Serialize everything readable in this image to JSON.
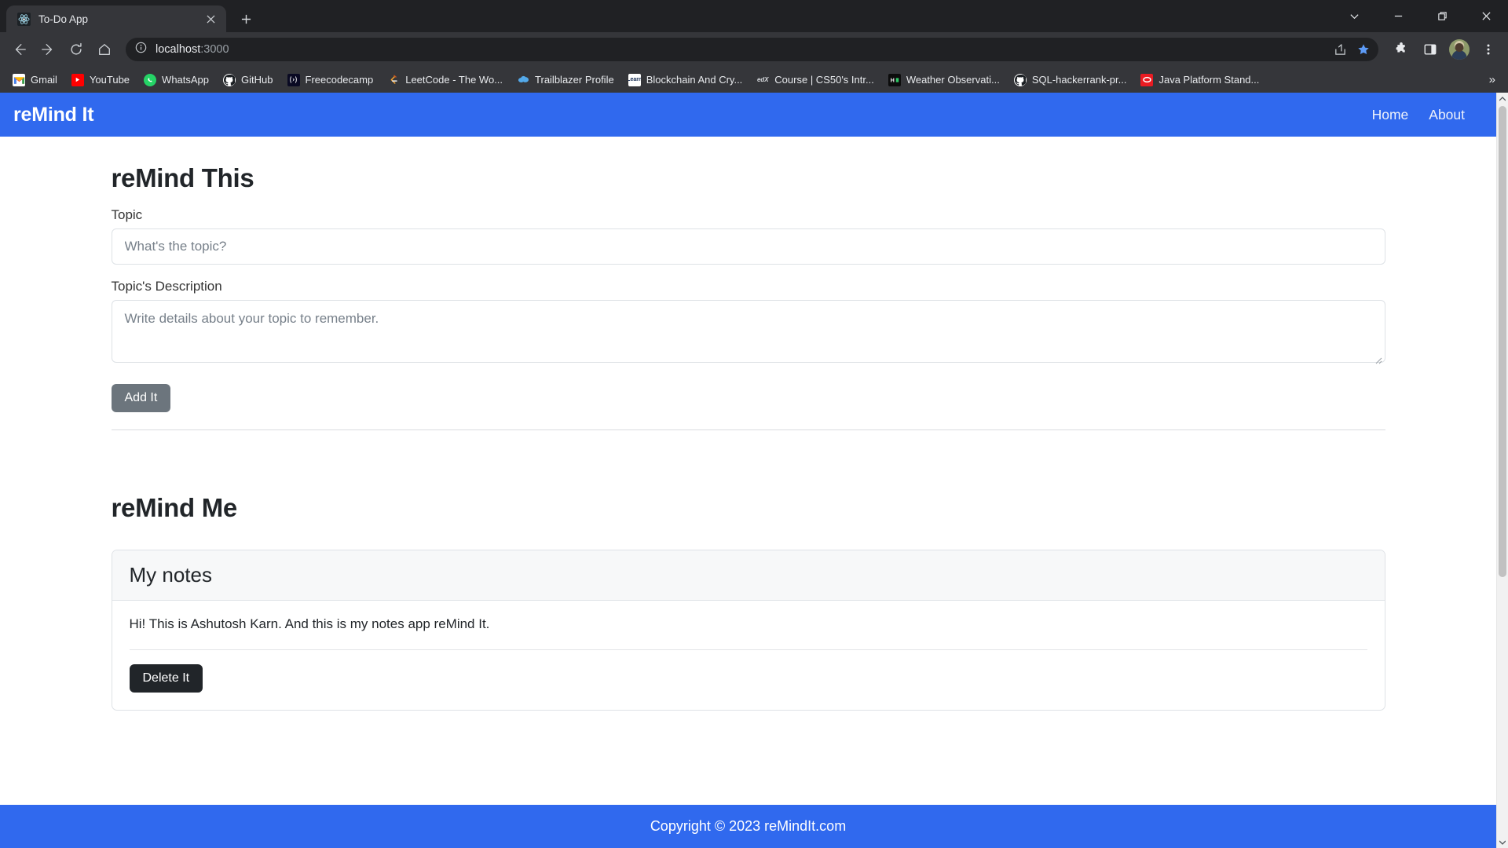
{
  "browser": {
    "tab": {
      "title": "To-Do App",
      "favicon": "react-icon"
    },
    "newtab_label": "+",
    "window_controls": [
      "chevron-down-icon",
      "minimize-icon",
      "restore-icon",
      "close-icon"
    ],
    "nav_buttons": [
      "back-icon",
      "forward-icon",
      "reload-icon",
      "home-icon"
    ],
    "omnibox": {
      "host": "localhost",
      "port": ":3000",
      "info_icon": "site-info-icon"
    },
    "toolbar_right": [
      "share-icon",
      "bookmark-star-icon",
      "extensions-icon",
      "side-panel-icon",
      "profile-avatar",
      "chrome-menu-icon"
    ],
    "bookmarks": [
      {
        "label": "Gmail",
        "icon": "gmail-icon"
      },
      {
        "label": "YouTube",
        "icon": "youtube-icon"
      },
      {
        "label": "WhatsApp",
        "icon": "whatsapp-icon"
      },
      {
        "label": "GitHub",
        "icon": "github-icon"
      },
      {
        "label": "Freecodecamp",
        "icon": "freecodecamp-icon"
      },
      {
        "label": "LeetCode - The Wo...",
        "icon": "leetcode-icon"
      },
      {
        "label": "Trailblazer Profile",
        "icon": "salesforce-icon"
      },
      {
        "label": "Blockchain And Cry...",
        "icon": "learn-icon"
      },
      {
        "label": "Course | CS50's Intr...",
        "icon": "edx-icon"
      },
      {
        "label": "Weather Observati...",
        "icon": "hackerrank-icon"
      },
      {
        "label": "SQL-hackerrank-pr...",
        "icon": "github-icon"
      },
      {
        "label": "Java Platform Stand...",
        "icon": "oracle-icon"
      }
    ],
    "bookmarks_overflow": "»"
  },
  "page": {
    "navbar": {
      "brand": "reMind It",
      "links": [
        {
          "label": "Home"
        },
        {
          "label": "About"
        }
      ]
    },
    "form_section": {
      "heading": "reMind This",
      "topic_label": "Topic",
      "topic_placeholder": "What's the topic?",
      "topic_value": "",
      "description_label": "Topic's Description",
      "description_placeholder": "Write details about your topic to remember.",
      "description_value": "",
      "submit_label": "Add It"
    },
    "notes_section": {
      "heading": "reMind Me",
      "notes": [
        {
          "title": "My notes",
          "body": "Hi! This is Ashutosh Karn. And this is my notes app reMind It.",
          "delete_label": "Delete It"
        }
      ]
    },
    "footer": {
      "text": "Copyright © 2023 reMindIt.com"
    },
    "colors": {
      "brand_blue": "#3069ee",
      "secondary_button": "#6c757d",
      "dark_button": "#212529"
    }
  }
}
